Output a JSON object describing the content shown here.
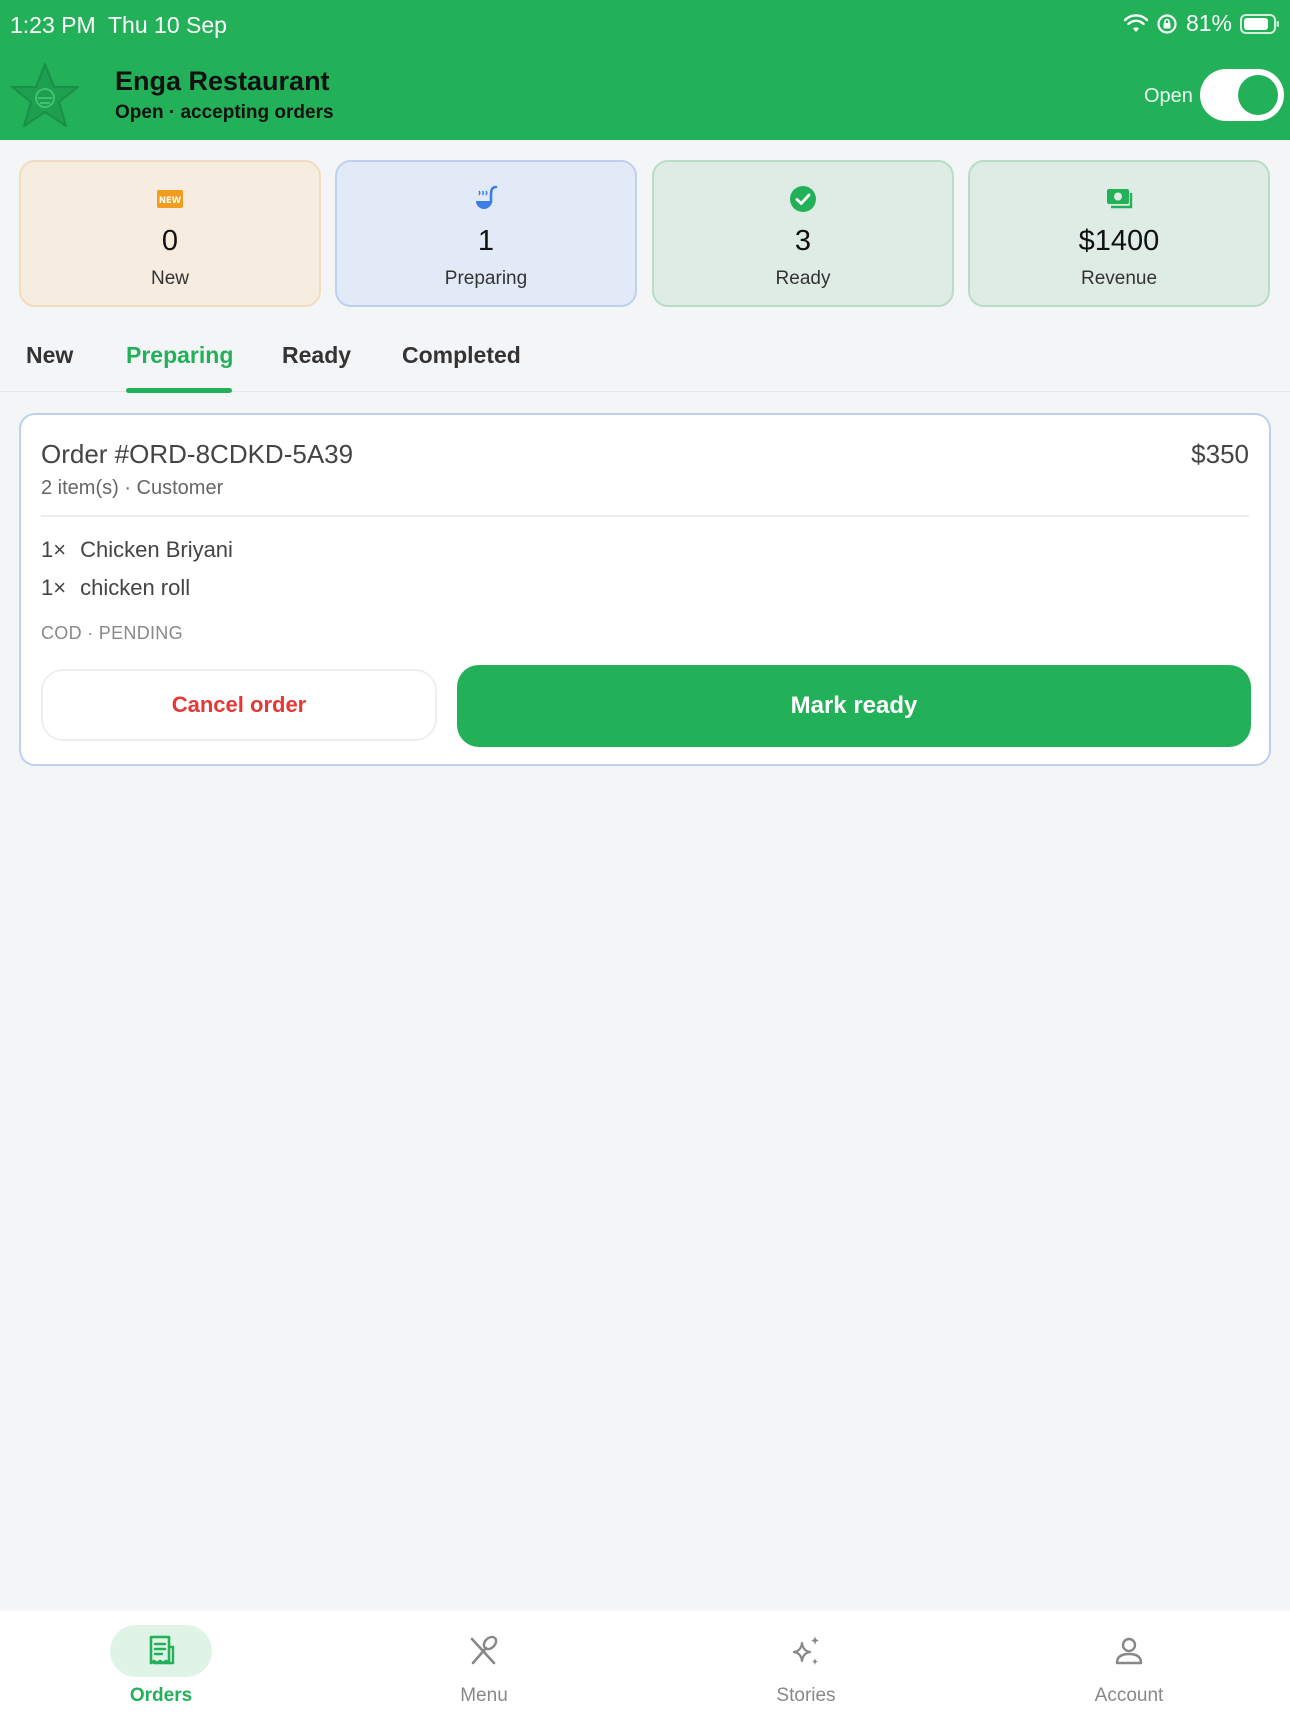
{
  "status_bar": {
    "time": "1:23 PM",
    "date": "Thu 10 Sep",
    "battery": "81%"
  },
  "header": {
    "restaurant_name": "Enga Restaurant",
    "status_text": "Open · accepting orders",
    "open_label": "Open",
    "open_toggle_on": true
  },
  "stats": [
    {
      "icon": "new-badge-icon",
      "value": "0",
      "label": "New"
    },
    {
      "icon": "ladle-icon",
      "value": "1",
      "label": "Preparing"
    },
    {
      "icon": "check-circle-icon",
      "value": "3",
      "label": "Ready"
    },
    {
      "icon": "money-icon",
      "value": "$1400",
      "label": "Revenue"
    }
  ],
  "tabs": [
    {
      "label": "New"
    },
    {
      "label": "Preparing"
    },
    {
      "label": "Ready"
    },
    {
      "label": "Completed"
    }
  ],
  "active_tab": "Preparing",
  "order": {
    "title": "Order #ORD-8CDKD-5A39",
    "price": "$350",
    "summary": "2 item(s) · Customer",
    "items": [
      {
        "qty": "1×",
        "name": "Chicken Briyani"
      },
      {
        "qty": "1×",
        "name": "chicken roll"
      }
    ],
    "meta": "COD · PENDING",
    "cancel_label": "Cancel order",
    "ready_label": "Mark ready"
  },
  "bottom_nav": [
    {
      "icon": "receipt-icon",
      "label": "Orders"
    },
    {
      "icon": "utensils-icon",
      "label": "Menu"
    },
    {
      "icon": "sparkle-icon",
      "label": "Stories"
    },
    {
      "icon": "person-icon",
      "label": "Account"
    }
  ],
  "colors": {
    "brand_green": "#22b158",
    "danger_red": "#e53935",
    "new_orange": "#f29c1f",
    "preparing_blue": "#3b7de0"
  }
}
